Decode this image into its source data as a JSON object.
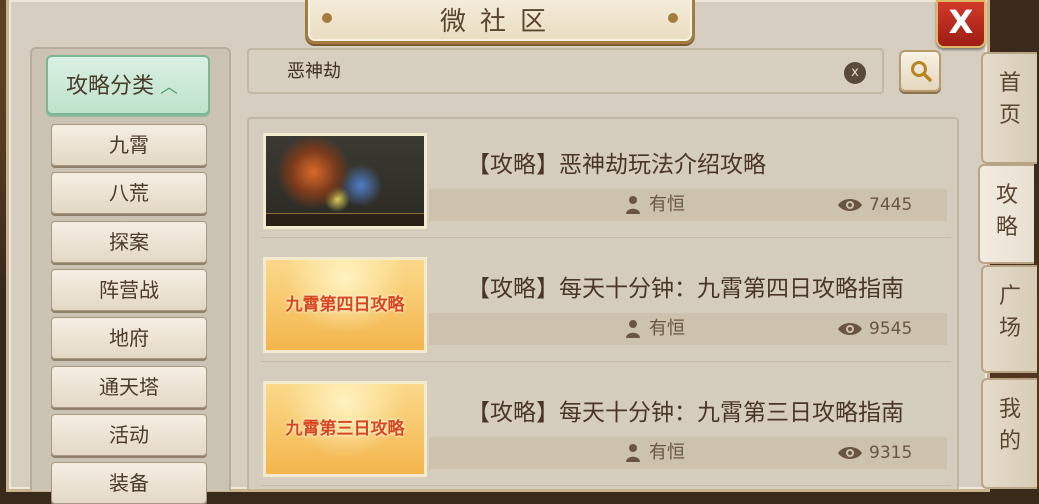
{
  "window": {
    "title": "微社区",
    "close_label": "X"
  },
  "sidebar": {
    "header_label": "攻略分类",
    "header_icon": "chevron-up-icon",
    "items": [
      {
        "label": "九霄"
      },
      {
        "label": "八荒"
      },
      {
        "label": "探案"
      },
      {
        "label": "阵营战"
      },
      {
        "label": "地府"
      },
      {
        "label": "通天塔"
      },
      {
        "label": "活动"
      },
      {
        "label": "装备"
      }
    ]
  },
  "search": {
    "value": "恶神劫",
    "clear_label": "x",
    "button_icon": "search-icon"
  },
  "articles": [
    {
      "title": "【攻略】恶神劫玩法介绍攻略",
      "thumb_text": "",
      "author": "有恒",
      "views": "7445"
    },
    {
      "title": "【攻略】每天十分钟：九霄第四日攻略指南",
      "thumb_text": "九霄第四日攻略",
      "author": "有恒",
      "views": "9545"
    },
    {
      "title": "【攻略】每天十分钟：九霄第三日攻略指南",
      "thumb_text": "九霄第三日攻略",
      "author": "有恒",
      "views": "9315"
    }
  ],
  "tabs": [
    {
      "label": "首页",
      "l1": "首",
      "l2": "页"
    },
    {
      "label": "攻略",
      "l1": "攻",
      "l2": "略"
    },
    {
      "label": "广场",
      "l1": "广",
      "l2": "场"
    },
    {
      "label": "我的",
      "l1": "我",
      "l2": "的"
    }
  ],
  "colors": {
    "accent_green": "#bfe3cc",
    "close_red": "#c42b1e",
    "text_brown": "#4a3627"
  }
}
